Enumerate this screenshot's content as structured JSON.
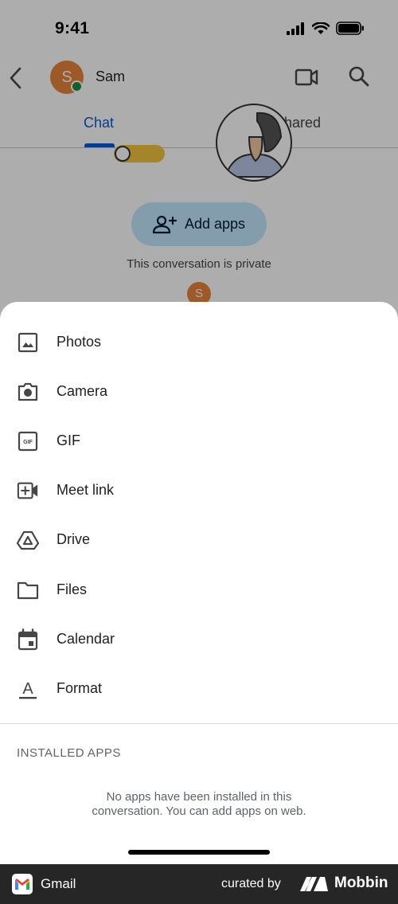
{
  "status_bar": {
    "time": "9:41"
  },
  "app_bar": {
    "contact_name": "Sam",
    "avatar_initial": "S"
  },
  "tabs": [
    {
      "label": "Chat",
      "selected": true
    },
    {
      "label": "Shared",
      "selected": false
    }
  ],
  "chat": {
    "add_apps_label": "Add apps",
    "private_note": "This conversation is private",
    "small_avatar_initial": "S"
  },
  "sheet": {
    "items": [
      {
        "label": "Photos",
        "icon": "photo-icon"
      },
      {
        "label": "Camera",
        "icon": "camera-icon"
      },
      {
        "label": "GIF",
        "icon": "gif-icon",
        "icon_text": "GIF"
      },
      {
        "label": "Meet link",
        "icon": "video-plus-icon"
      },
      {
        "label": "Drive",
        "icon": "drive-icon"
      },
      {
        "label": "Files",
        "icon": "folder-icon"
      },
      {
        "label": "Calendar",
        "icon": "calendar-icon"
      },
      {
        "label": "Format",
        "icon": "text-format-icon",
        "icon_text": "A"
      }
    ],
    "installed_apps_title": "INSTALLED APPS",
    "installed_apps_empty": "No apps have been installed in this conversation. You can add apps on web."
  },
  "footer": {
    "app_name": "Gmail",
    "curated_by": "curated by",
    "brand": "Mobbin"
  },
  "colors": {
    "accent": "#0b57d0",
    "avatar": "#e8833a",
    "presence": "#1e8e3e",
    "add_apps_bg": "#c2e7ff",
    "footer_bg": "#262626"
  }
}
